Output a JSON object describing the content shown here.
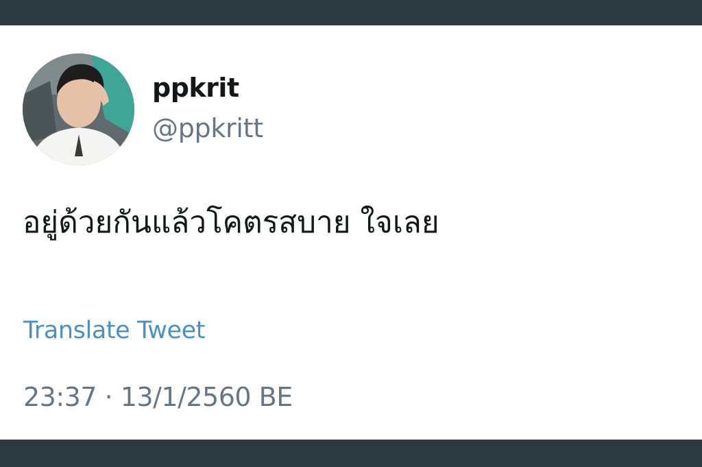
{
  "user": {
    "display_name": "ppkrit",
    "handle": "@ppkritt",
    "avatar": "profile-photo"
  },
  "tweet": {
    "text": "อยู่ด้วยกันแล้วโคตรสบาย ใจเลย",
    "translate_label": "Translate Tweet",
    "timestamp": "23:37 · 13/1/2560 BE"
  },
  "colors": {
    "chrome_bar": "#2e3a42",
    "name_text": "#14171a",
    "secondary_text": "#657786",
    "link": "#4a90c8"
  }
}
